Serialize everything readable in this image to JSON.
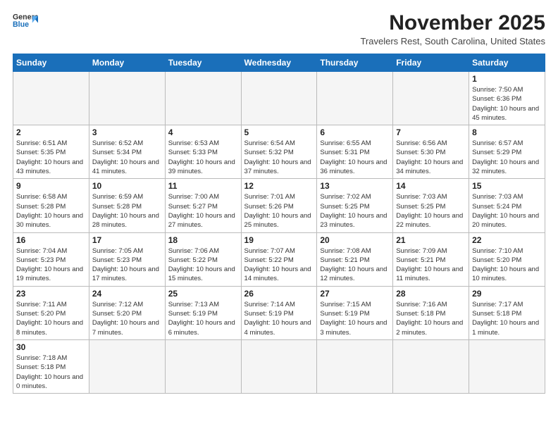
{
  "logo": {
    "line1": "General",
    "line2": "Blue"
  },
  "title": "November 2025",
  "subtitle": "Travelers Rest, South Carolina, United States",
  "weekdays": [
    "Sunday",
    "Monday",
    "Tuesday",
    "Wednesday",
    "Thursday",
    "Friday",
    "Saturday"
  ],
  "weeks": [
    [
      {
        "day": "",
        "info": ""
      },
      {
        "day": "",
        "info": ""
      },
      {
        "day": "",
        "info": ""
      },
      {
        "day": "",
        "info": ""
      },
      {
        "day": "",
        "info": ""
      },
      {
        "day": "",
        "info": ""
      },
      {
        "day": "1",
        "info": "Sunrise: 7:50 AM\nSunset: 6:36 PM\nDaylight: 10 hours and 45 minutes."
      }
    ],
    [
      {
        "day": "2",
        "info": "Sunrise: 6:51 AM\nSunset: 5:35 PM\nDaylight: 10 hours and 43 minutes."
      },
      {
        "day": "3",
        "info": "Sunrise: 6:52 AM\nSunset: 5:34 PM\nDaylight: 10 hours and 41 minutes."
      },
      {
        "day": "4",
        "info": "Sunrise: 6:53 AM\nSunset: 5:33 PM\nDaylight: 10 hours and 39 minutes."
      },
      {
        "day": "5",
        "info": "Sunrise: 6:54 AM\nSunset: 5:32 PM\nDaylight: 10 hours and 37 minutes."
      },
      {
        "day": "6",
        "info": "Sunrise: 6:55 AM\nSunset: 5:31 PM\nDaylight: 10 hours and 36 minutes."
      },
      {
        "day": "7",
        "info": "Sunrise: 6:56 AM\nSunset: 5:30 PM\nDaylight: 10 hours and 34 minutes."
      },
      {
        "day": "8",
        "info": "Sunrise: 6:57 AM\nSunset: 5:29 PM\nDaylight: 10 hours and 32 minutes."
      }
    ],
    [
      {
        "day": "9",
        "info": "Sunrise: 6:58 AM\nSunset: 5:28 PM\nDaylight: 10 hours and 30 minutes."
      },
      {
        "day": "10",
        "info": "Sunrise: 6:59 AM\nSunset: 5:28 PM\nDaylight: 10 hours and 28 minutes."
      },
      {
        "day": "11",
        "info": "Sunrise: 7:00 AM\nSunset: 5:27 PM\nDaylight: 10 hours and 27 minutes."
      },
      {
        "day": "12",
        "info": "Sunrise: 7:01 AM\nSunset: 5:26 PM\nDaylight: 10 hours and 25 minutes."
      },
      {
        "day": "13",
        "info": "Sunrise: 7:02 AM\nSunset: 5:25 PM\nDaylight: 10 hours and 23 minutes."
      },
      {
        "day": "14",
        "info": "Sunrise: 7:03 AM\nSunset: 5:25 PM\nDaylight: 10 hours and 22 minutes."
      },
      {
        "day": "15",
        "info": "Sunrise: 7:03 AM\nSunset: 5:24 PM\nDaylight: 10 hours and 20 minutes."
      }
    ],
    [
      {
        "day": "16",
        "info": "Sunrise: 7:04 AM\nSunset: 5:23 PM\nDaylight: 10 hours and 19 minutes."
      },
      {
        "day": "17",
        "info": "Sunrise: 7:05 AM\nSunset: 5:23 PM\nDaylight: 10 hours and 17 minutes."
      },
      {
        "day": "18",
        "info": "Sunrise: 7:06 AM\nSunset: 5:22 PM\nDaylight: 10 hours and 15 minutes."
      },
      {
        "day": "19",
        "info": "Sunrise: 7:07 AM\nSunset: 5:22 PM\nDaylight: 10 hours and 14 minutes."
      },
      {
        "day": "20",
        "info": "Sunrise: 7:08 AM\nSunset: 5:21 PM\nDaylight: 10 hours and 12 minutes."
      },
      {
        "day": "21",
        "info": "Sunrise: 7:09 AM\nSunset: 5:21 PM\nDaylight: 10 hours and 11 minutes."
      },
      {
        "day": "22",
        "info": "Sunrise: 7:10 AM\nSunset: 5:20 PM\nDaylight: 10 hours and 10 minutes."
      }
    ],
    [
      {
        "day": "23",
        "info": "Sunrise: 7:11 AM\nSunset: 5:20 PM\nDaylight: 10 hours and 8 minutes."
      },
      {
        "day": "24",
        "info": "Sunrise: 7:12 AM\nSunset: 5:20 PM\nDaylight: 10 hours and 7 minutes."
      },
      {
        "day": "25",
        "info": "Sunrise: 7:13 AM\nSunset: 5:19 PM\nDaylight: 10 hours and 6 minutes."
      },
      {
        "day": "26",
        "info": "Sunrise: 7:14 AM\nSunset: 5:19 PM\nDaylight: 10 hours and 4 minutes."
      },
      {
        "day": "27",
        "info": "Sunrise: 7:15 AM\nSunset: 5:19 PM\nDaylight: 10 hours and 3 minutes."
      },
      {
        "day": "28",
        "info": "Sunrise: 7:16 AM\nSunset: 5:18 PM\nDaylight: 10 hours and 2 minutes."
      },
      {
        "day": "29",
        "info": "Sunrise: 7:17 AM\nSunset: 5:18 PM\nDaylight: 10 hours and 1 minute."
      }
    ],
    [
      {
        "day": "30",
        "info": "Sunrise: 7:18 AM\nSunset: 5:18 PM\nDaylight: 10 hours and 0 minutes."
      },
      {
        "day": "",
        "info": ""
      },
      {
        "day": "",
        "info": ""
      },
      {
        "day": "",
        "info": ""
      },
      {
        "day": "",
        "info": ""
      },
      {
        "day": "",
        "info": ""
      },
      {
        "day": "",
        "info": ""
      }
    ]
  ]
}
